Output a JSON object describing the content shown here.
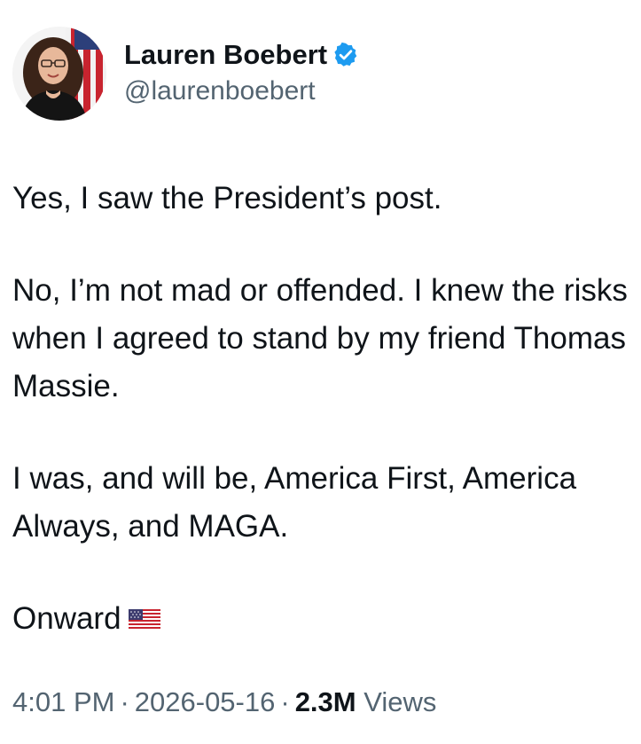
{
  "author": {
    "display_name": "Lauren Boebert",
    "handle": "@laurenboebert",
    "verified_badge_color": "#1d9bf0"
  },
  "post": {
    "paragraphs": [
      "Yes, I saw the President’s post.",
      "No, I’m not mad or offended. I knew the risks when I agreed to stand by my friend Thomas Massie.",
      "I was, and will be, America First, America Always, and MAGA.",
      "Onward"
    ],
    "emoji_icon": "us-flag-icon"
  },
  "meta": {
    "time": "4:01 PM",
    "separator": "·",
    "date": "2026-05-16",
    "views_count": "2.3M",
    "views_label": "Views"
  },
  "colors": {
    "text_primary": "#0f1419",
    "text_secondary": "#536471",
    "background": "#ffffff"
  }
}
